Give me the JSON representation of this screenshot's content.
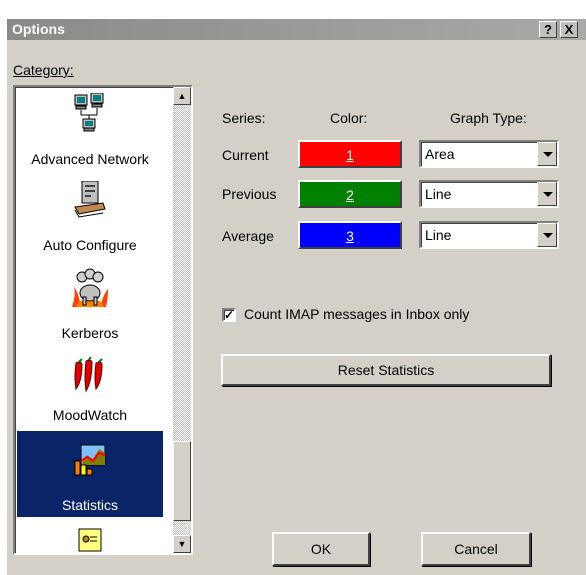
{
  "window": {
    "title": "Options",
    "help_label": "?",
    "close_label": "X"
  },
  "category": {
    "label": "Category:",
    "items": [
      {
        "label": "Advanced Network",
        "icon": "network-computers-icon"
      },
      {
        "label": "Auto Configure",
        "icon": "server-hand-icon"
      },
      {
        "label": "Kerberos",
        "icon": "kerberos-dog-icon"
      },
      {
        "label": "MoodWatch",
        "icon": "chili-peppers-icon"
      },
      {
        "label": "Statistics",
        "icon": "statistics-chart-icon",
        "selected": true
      },
      {
        "label": "",
        "icon": "document-icon"
      }
    ]
  },
  "headers": {
    "series": "Series:",
    "color": "Color:",
    "graph_type": "Graph Type:"
  },
  "series": [
    {
      "name": "Current",
      "color_label": "1",
      "color": "#ff0000",
      "graph_type": "Area"
    },
    {
      "name": "Previous",
      "color_label": "2",
      "color": "#008000",
      "graph_type": "Line"
    },
    {
      "name": "Average",
      "color_label": "3",
      "color": "#0000ff",
      "graph_type": "Line"
    }
  ],
  "imap_checkbox": {
    "label": "Count IMAP messages in Inbox only",
    "checked": true
  },
  "buttons": {
    "reset": "Reset Statistics",
    "ok": "OK",
    "cancel": "Cancel"
  }
}
